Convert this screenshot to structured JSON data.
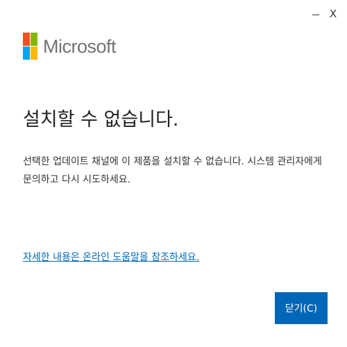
{
  "titlebar": {
    "minimize_glyph": "–",
    "close_glyph": "X"
  },
  "logo": {
    "text": "Microsoft",
    "colors": {
      "red": "#f25022",
      "green": "#7fba00",
      "blue": "#00a4ef",
      "yellow": "#ffb900"
    }
  },
  "dialog": {
    "heading": "설치할 수 없습니다.",
    "message": "선택한 업데이트 채널에 이 제품을 설치할 수 없습니다. 시스템 관리자에게 문의하고 다시 시도하세요.",
    "help_link": "자세한 내용은 온라인 도움말을 참조하세요.",
    "close_button": "닫기(C)"
  },
  "colors": {
    "accent": "#0067b8",
    "link": "#0067b8",
    "heading_text": "#222222",
    "body_text": "#333333"
  }
}
